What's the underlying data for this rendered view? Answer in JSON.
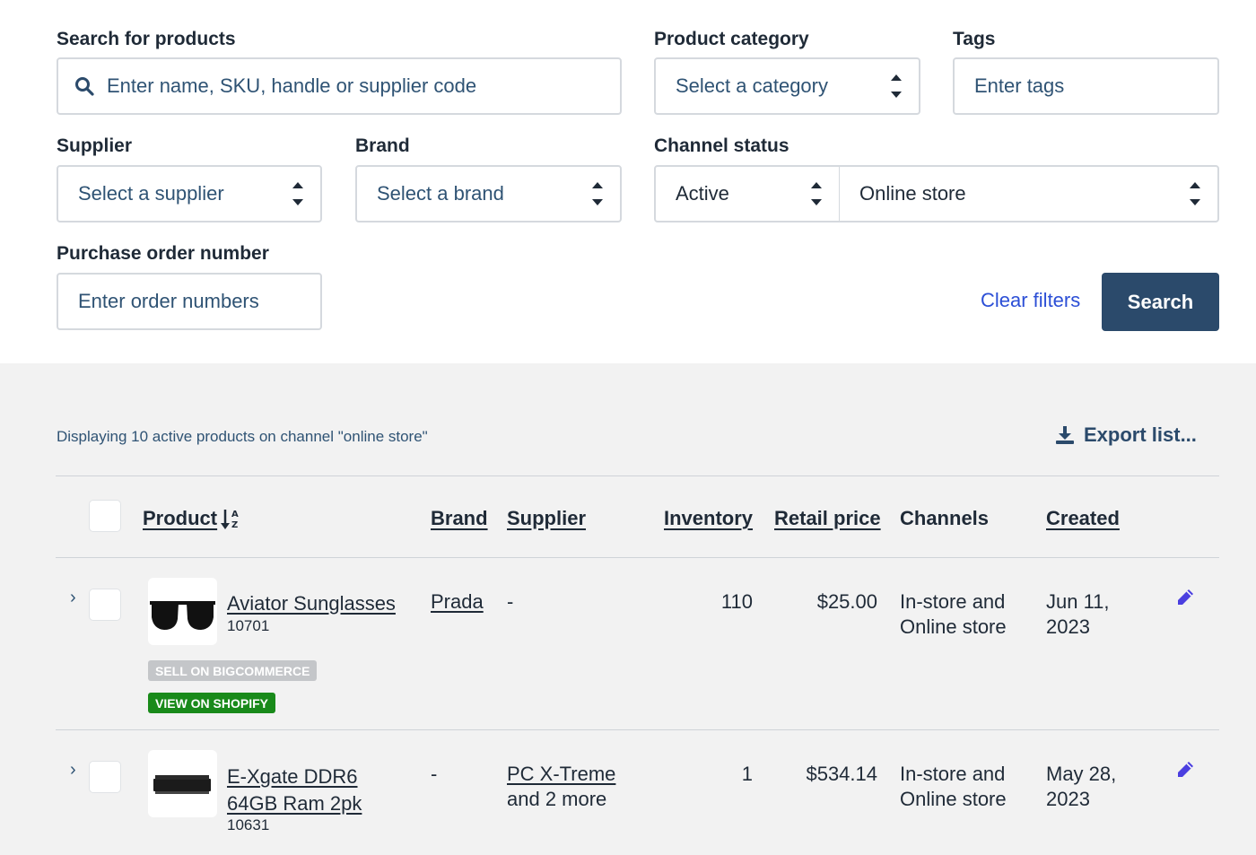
{
  "filters": {
    "search": {
      "label": "Search for products",
      "placeholder": "Enter name, SKU, handle or supplier code"
    },
    "category": {
      "label": "Product category",
      "placeholder": "Select a category"
    },
    "tags": {
      "label": "Tags",
      "placeholder": "Enter tags"
    },
    "supplier": {
      "label": "Supplier",
      "placeholder": "Select a supplier"
    },
    "brand": {
      "label": "Brand",
      "placeholder": "Select a brand"
    },
    "channel_status": {
      "label": "Channel status",
      "status_value": "Active",
      "channel_value": "Online store"
    },
    "purchase_order": {
      "label": "Purchase order number",
      "placeholder": "Enter order numbers"
    },
    "clear_label": "Clear filters",
    "search_button": "Search"
  },
  "results": {
    "summary": "Displaying 10 active products on channel \"online store\"",
    "export_label": "Export list..."
  },
  "table": {
    "headers": {
      "product": "Product",
      "brand": "Brand",
      "supplier": "Supplier",
      "inventory": "Inventory",
      "retail_price": "Retail price",
      "channels": "Channels",
      "created": "Created"
    },
    "rows": [
      {
        "name": "Aviator Sunglasses",
        "sku": "10701",
        "brand": "Prada",
        "supplier": "-",
        "inventory": "110",
        "price": "$25.00",
        "channels": "In-store and Online store",
        "created": "Jun 11, 2023",
        "badges": [
          "SELL ON BIGCOMMERCE",
          "VIEW ON SHOPIFY"
        ]
      },
      {
        "name": "E-Xgate DDR6 64GB Ram 2pk",
        "sku": "10631",
        "brand": "-",
        "supplier": "PC X-Treme",
        "supplier_more": "and 2 more",
        "inventory": "1",
        "price": "$534.14",
        "channels": "In-store and Online store",
        "created": "May 28, 2023"
      }
    ]
  },
  "colors": {
    "primary": "#2b4a6b",
    "link": "#2c4fd6",
    "badge_gray": "#c4c6c9",
    "badge_green": "#198a1a",
    "edit_icon": "#4b3fe0"
  }
}
